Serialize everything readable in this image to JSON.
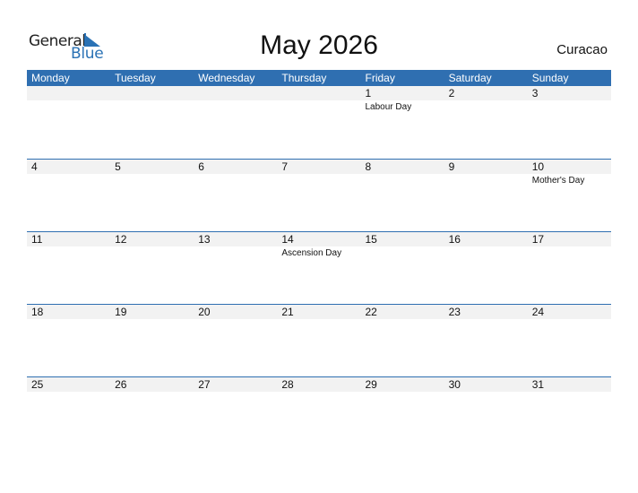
{
  "logo": {
    "word1": "General",
    "word2": "Blue"
  },
  "title": "May 2026",
  "country": "Curacao",
  "colors": {
    "accent": "#2f6fb1",
    "strip": "#f2f2f2"
  },
  "weekdays": [
    "Monday",
    "Tuesday",
    "Wednesday",
    "Thursday",
    "Friday",
    "Saturday",
    "Sunday"
  ],
  "weeks": [
    {
      "days": [
        {
          "num": "",
          "event": ""
        },
        {
          "num": "",
          "event": ""
        },
        {
          "num": "",
          "event": ""
        },
        {
          "num": "",
          "event": ""
        },
        {
          "num": "1",
          "event": "Labour Day"
        },
        {
          "num": "2",
          "event": ""
        },
        {
          "num": "3",
          "event": ""
        }
      ]
    },
    {
      "days": [
        {
          "num": "4",
          "event": ""
        },
        {
          "num": "5",
          "event": ""
        },
        {
          "num": "6",
          "event": ""
        },
        {
          "num": "7",
          "event": ""
        },
        {
          "num": "8",
          "event": ""
        },
        {
          "num": "9",
          "event": ""
        },
        {
          "num": "10",
          "event": "Mother's Day"
        }
      ]
    },
    {
      "days": [
        {
          "num": "11",
          "event": ""
        },
        {
          "num": "12",
          "event": ""
        },
        {
          "num": "13",
          "event": ""
        },
        {
          "num": "14",
          "event": "Ascension Day"
        },
        {
          "num": "15",
          "event": ""
        },
        {
          "num": "16",
          "event": ""
        },
        {
          "num": "17",
          "event": ""
        }
      ]
    },
    {
      "days": [
        {
          "num": "18",
          "event": ""
        },
        {
          "num": "19",
          "event": ""
        },
        {
          "num": "20",
          "event": ""
        },
        {
          "num": "21",
          "event": ""
        },
        {
          "num": "22",
          "event": ""
        },
        {
          "num": "23",
          "event": ""
        },
        {
          "num": "24",
          "event": ""
        }
      ]
    },
    {
      "days": [
        {
          "num": "25",
          "event": ""
        },
        {
          "num": "26",
          "event": ""
        },
        {
          "num": "27",
          "event": ""
        },
        {
          "num": "28",
          "event": ""
        },
        {
          "num": "29",
          "event": ""
        },
        {
          "num": "30",
          "event": ""
        },
        {
          "num": "31",
          "event": ""
        }
      ]
    }
  ]
}
